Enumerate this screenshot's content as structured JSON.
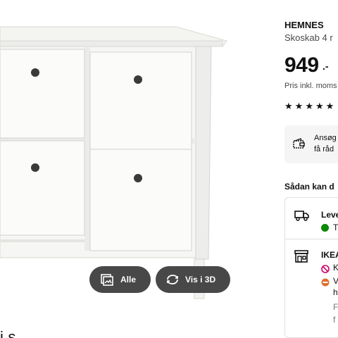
{
  "gallery": {
    "all_button_label": "Alle",
    "view_3d_button_label": "Vis i 3D",
    "caption_fragment": "i   s"
  },
  "product": {
    "name": "HEMNES",
    "subtitle": "Skoskab 4 r",
    "price": "949",
    "price_suffix": ".-",
    "price_note": "Pris inkl. moms",
    "rating_stars": 5
  },
  "apply_card": {
    "line1": "Ansøg",
    "line2": "få råd"
  },
  "availability": {
    "heading": "Sådan kan d",
    "delivery_title": "Leve",
    "delivery_status": "T",
    "store_title": "IKEA",
    "store_row1": "K",
    "store_row2": "V",
    "store_row3": "h",
    "store_row4": "F",
    "store_row5": "f"
  },
  "colors": {
    "button_bg": "#484848",
    "in_stock_green": "#0a8a00",
    "not_available_pink": "#cc0066",
    "limited_orange": "#e06f2b"
  }
}
